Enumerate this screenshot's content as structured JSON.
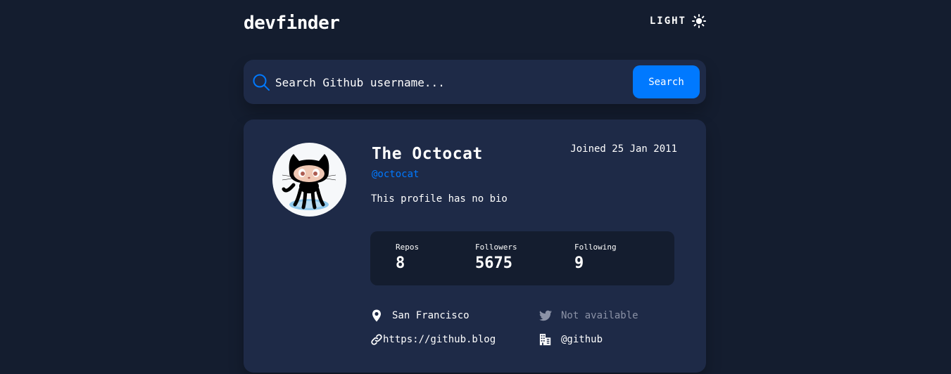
{
  "header": {
    "logo": "devfinder",
    "theme_label": "LIGHT",
    "theme_icon": "sun-icon"
  },
  "search": {
    "placeholder": "Search Github username...",
    "button_label": "Search",
    "icon": "search-icon"
  },
  "profile": {
    "name": "The Octocat",
    "login": "@octocat",
    "joined": "Joined 25 Jan 2011",
    "bio": "This profile has no bio",
    "avatar_icon": "octocat-avatar",
    "stats": [
      {
        "label": "Repos",
        "value": "8"
      },
      {
        "label": "Followers",
        "value": "5675"
      },
      {
        "label": "Following",
        "value": "9"
      }
    ],
    "links": {
      "location": "San Francisco",
      "twitter": "Not available",
      "blog": "https://github.blog",
      "company": "@github"
    }
  },
  "colors": {
    "background": "#141D2F",
    "card": "#1E2A47",
    "accent": "#0079FF",
    "muted": "#8B92A6"
  }
}
